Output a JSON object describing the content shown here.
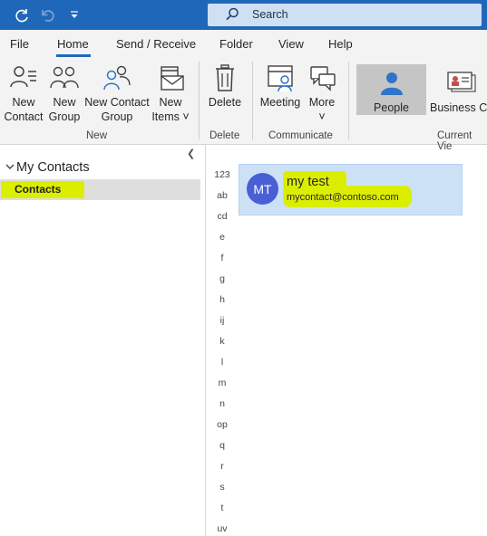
{
  "colors": {
    "title_bar": "#1f68b9",
    "avatar": "#4a5fd6",
    "card": "#cce1f6",
    "highlight": "#dcee00"
  },
  "titlebar": {
    "search_placeholder": "Search",
    "icons": [
      "sync-icon",
      "undo-icon",
      "customize-icon",
      "search-icon"
    ]
  },
  "menu": {
    "tabs": [
      "File",
      "Home",
      "Send / Receive",
      "Folder",
      "View",
      "Help"
    ],
    "active": "Home"
  },
  "ribbon": {
    "new_contact": "New\nContact",
    "new_group": "New\nGroup",
    "new_contact_group": "New Contact\nGroup",
    "new_items": "New\nItems ˅",
    "delete": "Delete",
    "meeting": "Meeting",
    "more": "More\n˅",
    "people": "People",
    "business_card": "Business C...",
    "groups": {
      "new": "New",
      "delete": "Delete",
      "communicate": "Communicate",
      "current_view": "Current Vie"
    }
  },
  "folders": {
    "section": "My Contacts",
    "selected": "Contacts"
  },
  "alphabet": [
    "123",
    "ab",
    "cd",
    "e",
    "f",
    "g",
    "h",
    "ij",
    "k",
    "l",
    "m",
    "n",
    "op",
    "q",
    "r",
    "s",
    "t",
    "uv"
  ],
  "contact": {
    "initials": "MT",
    "name": "my test",
    "email": "mycontact@contoso.com"
  }
}
